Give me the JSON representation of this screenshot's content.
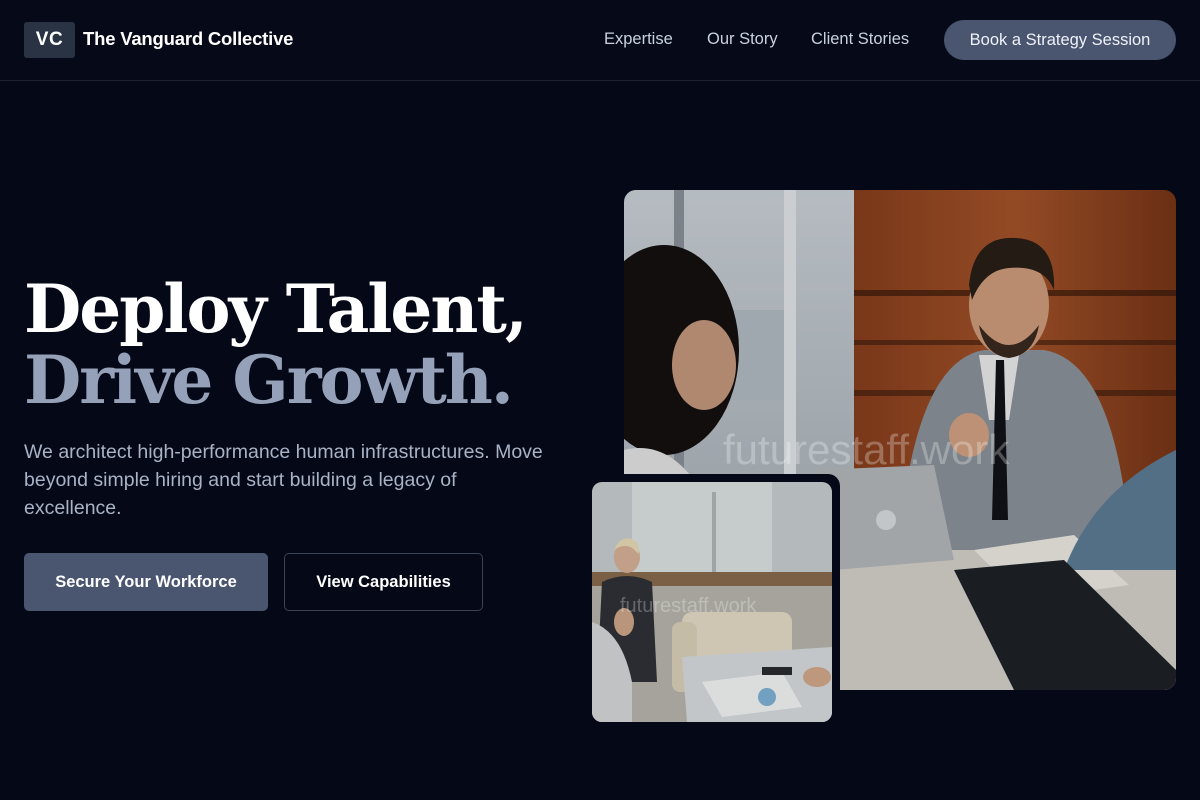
{
  "header": {
    "logo_initials": "VC",
    "brand": "The Vanguard Collective",
    "nav": [
      "Expertise",
      "Our Story",
      "Client Stories"
    ],
    "cta": "Book a Strategy Session"
  },
  "hero": {
    "line1": "Deploy Talent,",
    "line2": "Drive Growth.",
    "description": "We architect high-performance human infrastructures. Move beyond simple hiring and start building a legacy of excellence.",
    "primary_button": "Secure Your Workforce",
    "secondary_button": "View Capabilities"
  },
  "images": {
    "large_watermark": "futurestaff.work",
    "small_watermark": "futurestaff.work"
  },
  "colors": {
    "background": "#050816",
    "accent": "#4a5670",
    "heading_secondary": "#95a1b8"
  }
}
